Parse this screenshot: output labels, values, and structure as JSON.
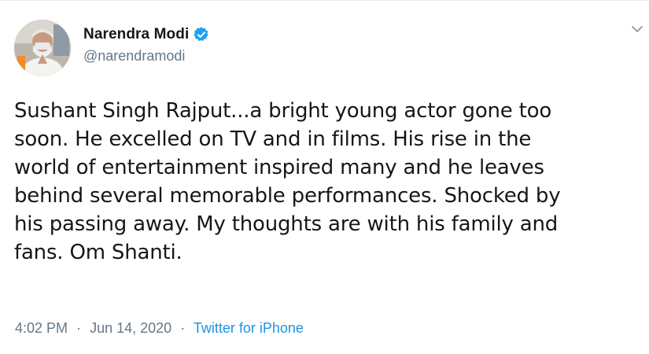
{
  "tweet": {
    "author": {
      "display_name": "Narendra Modi",
      "handle": "@narendramodi",
      "verified": true,
      "avatar_icon": "profile-photo-avatar"
    },
    "text": "Sushant Singh Rajput...a bright young actor gone too\nsoon. He excelled on TV and in films. His rise in the\nworld of entertainment inspired many and he leaves\nbehind several memorable performances. Shocked by\nhis passing away. My thoughts are with his family and\nfans. Om Shanti.",
    "time": "4:02 PM",
    "separator": "·",
    "date": "Jun 14, 2020",
    "source": "Twitter for iPhone"
  },
  "colors": {
    "verified_badge": "#1da1f2",
    "link": "#1b95e0",
    "meta_gray": "#657786",
    "text": "#14171a"
  },
  "icons": {
    "verified": "verified-badge-icon",
    "menu": "chevron-down-icon"
  }
}
